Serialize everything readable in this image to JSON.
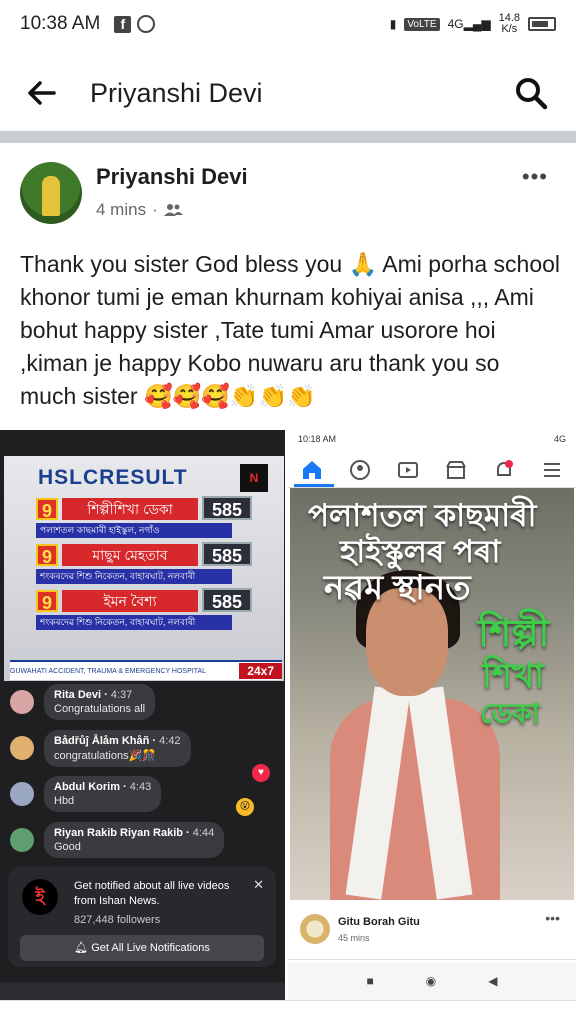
{
  "status_bar": {
    "time": "10:38 AM",
    "network": "VoLTE",
    "signal": "4G",
    "speed_value": "14.8",
    "speed_unit": "K/s"
  },
  "header": {
    "title": "Priyanshi Devi"
  },
  "post": {
    "author": "Priyanshi Devi",
    "time": "4 mins",
    "text": "Thank you sister God bless you 🙏 Ami porha school khonor tumi je eman khurnam kohiyai anisa ,,, Ami bohut happy sister ,Tate tumi Amar usorore hoi ,kiman je happy Kobo nuwaru aru thank you so much sister 🥰🥰🥰👏👏👏"
  },
  "left_screenshot": {
    "banner_title": "HSLCRESULT",
    "ranks": [
      {
        "rank": "9",
        "name": "শিল্পীশিখা ডেকা",
        "score": "585",
        "school": "পলাশতল কাছমাৰী হাইস্কুল, নগাঁও"
      },
      {
        "rank": "9",
        "name": "মাছুম মেহতাব",
        "score": "585",
        "school": "শংকৰদেৱ শিশু নিকেতন, বাহাৰঘাট, নলবাৰী"
      },
      {
        "rank": "9",
        "name": "ইমন বৈশ্য",
        "score": "585",
        "school": "শংকৰদেৱ শিশু নিকেতন, বাহাৰঘাট, নলবাৰী"
      }
    ],
    "ticker_text": "GUWAHATI ACCIDENT, TRAUMA & EMERGENCY HOSPITAL",
    "ticker_tag": "24x7",
    "comments": [
      {
        "name": "Rita Devi",
        "time": "4:37",
        "text": "Congratulations all",
        "color": "#d9a6a6"
      },
      {
        "name": "Bådřůĵ Ålåm Khåñ",
        "time": "4:42",
        "text": "congratulations🎉🎊",
        "color": "#e0b070"
      },
      {
        "name": "Abdul Korim",
        "time": "4:43",
        "text": "Hbd",
        "color": "#9aa7c2"
      },
      {
        "name": "Riyan Rakib Riyan Rakib",
        "time": "4:44",
        "text": "Good",
        "color": "#5f9e6e"
      }
    ],
    "notify": {
      "text": "Get notified about all live videos from Ishan News.",
      "followers": "827,448 followers",
      "button": "Get All Live Notifications"
    }
  },
  "right_screenshot": {
    "status_time": "10:18 AM",
    "status_right": "4G",
    "overlay": [
      "পলাশতল কাছমাৰী",
      "হাইস্কুলৰ পৰা",
      "নৱম স্থানত",
      "শিল্পী",
      "শিখা",
      "ডেকা"
    ],
    "post_author": "Gitu Borah Gitu",
    "post_time": "45 mins"
  },
  "colors": {
    "fb_blue": "#1877f2",
    "green_text": "#3ecf4a"
  }
}
